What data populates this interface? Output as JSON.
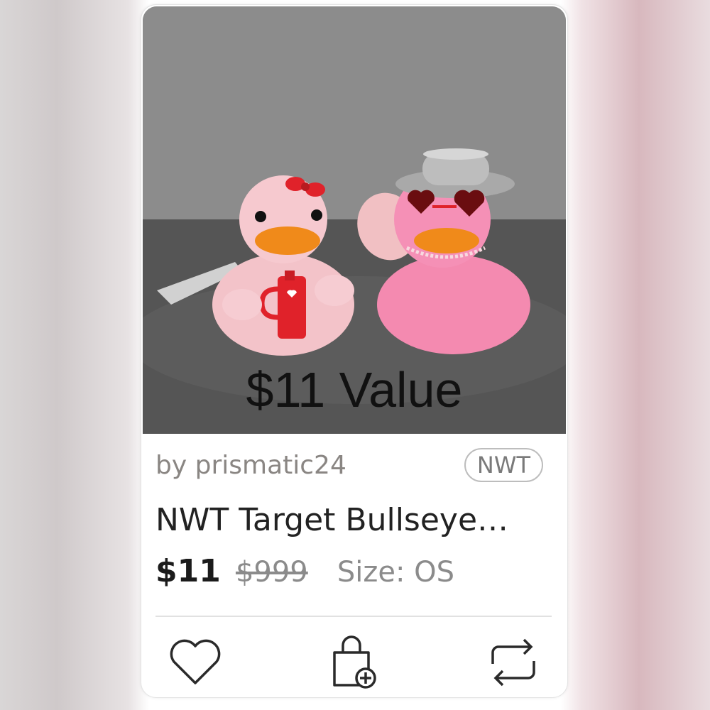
{
  "listing": {
    "overlay_text": "$11 Value",
    "seller": "by prismatic24",
    "condition_badge": "NWT",
    "title": "NWT Target Bullseye…",
    "price": "$11",
    "original_price": "$999",
    "size": "Size: OS"
  },
  "actions": {
    "like_icon": "heart-icon",
    "bundle_icon": "shopping-bag-plus-icon",
    "share_icon": "share-arrows-icon"
  },
  "colors": {
    "text_primary": "#222222",
    "text_muted": "#8a8683",
    "duck_pink_light": "#f4bfc6",
    "duck_pink_bright": "#f48ab0",
    "accent_red": "#e0222a"
  }
}
